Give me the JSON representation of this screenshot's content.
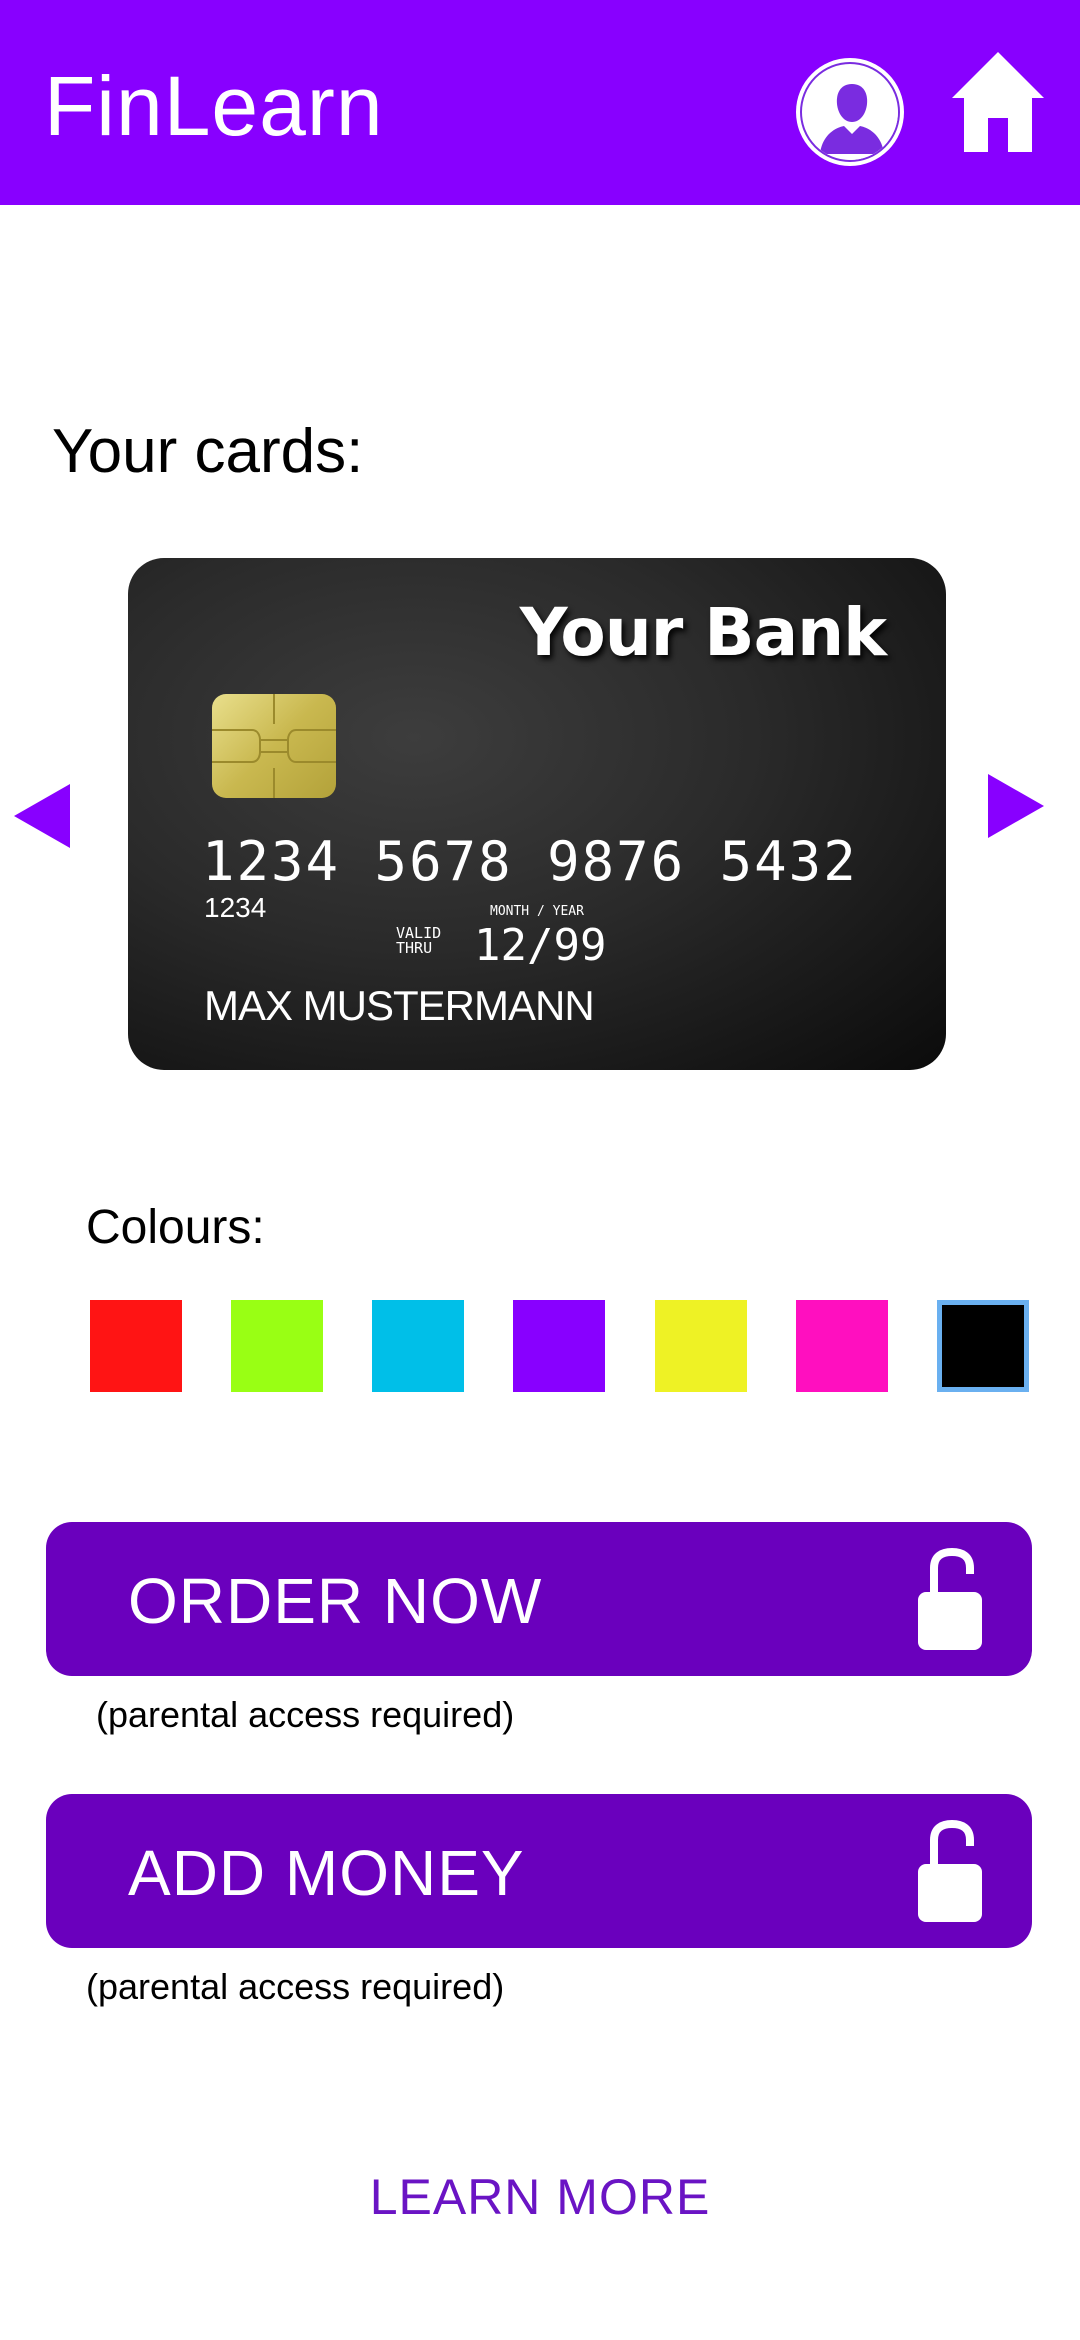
{
  "header": {
    "app_title": "FinLearn",
    "profile_icon": "user-avatar-icon",
    "home_icon": "home-icon",
    "background_color": "#8800ff"
  },
  "main": {
    "section_title": "Your cards:",
    "carousel": {
      "prev_icon": "triangle-left-icon",
      "next_icon": "triangle-right-icon",
      "arrow_color": "#8800ff"
    },
    "card": {
      "bank_name": "Your Bank",
      "number": "1234 5678 9876 5432",
      "number_small": "1234",
      "valid_thru_label": "VALID THRU",
      "month_year_label": "MONTH / YEAR",
      "expiry": "12/99",
      "holder_name": "MAX MUSTERMANN",
      "selected_color": "#000000"
    },
    "colours": {
      "label": "Colours:",
      "options": [
        {
          "name": "red",
          "hex": "#ff1414"
        },
        {
          "name": "green",
          "hex": "#99ff14"
        },
        {
          "name": "cyan",
          "hex": "#00bfe8"
        },
        {
          "name": "purple",
          "hex": "#8800ff"
        },
        {
          "name": "yellow",
          "hex": "#eef225"
        },
        {
          "name": "pink",
          "hex": "#ff0fbf"
        },
        {
          "name": "black",
          "hex": "#000000",
          "selected": true
        }
      ]
    },
    "actions": [
      {
        "label": "ORDER NOW",
        "note": "(parental access required)",
        "icon": "lock-open-icon"
      },
      {
        "label": "ADD MONEY",
        "note": "(parental access required)",
        "icon": "lock-open-icon"
      }
    ],
    "button_color": "#6a00bd",
    "learn_more": "LEARN MORE"
  }
}
